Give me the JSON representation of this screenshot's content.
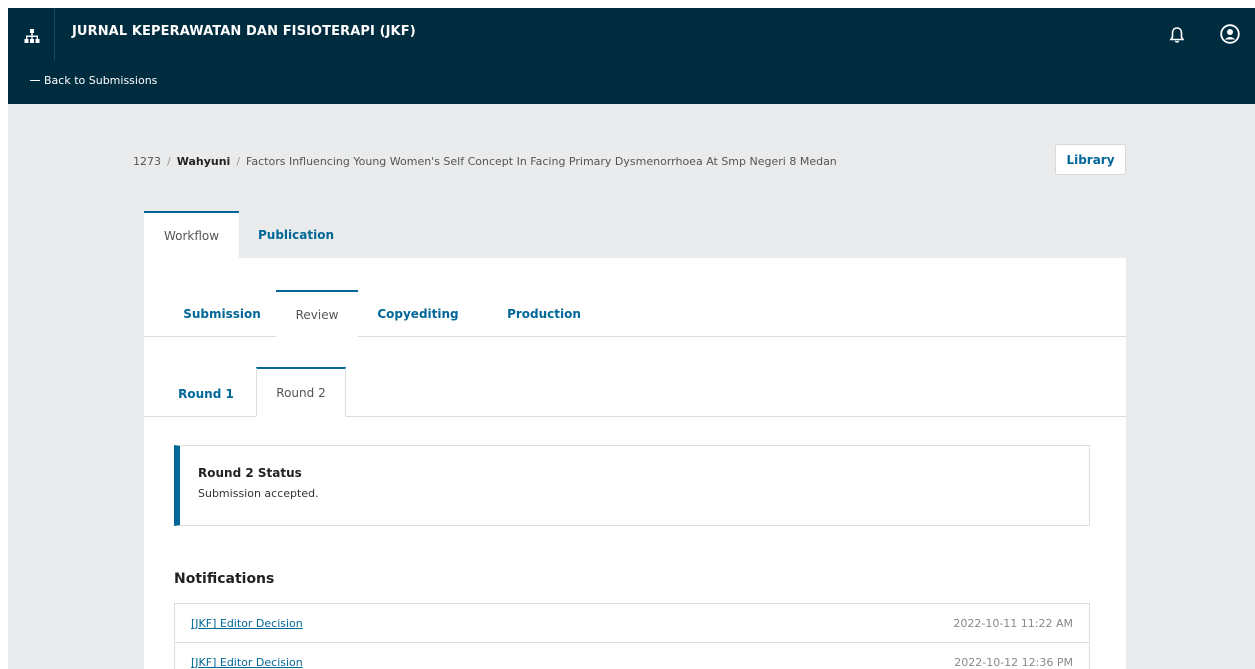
{
  "header": {
    "site_title": "JURNAL KEPERAWATAN DAN FISIOTERAPI (JKF)",
    "back_label": "Back to Submissions"
  },
  "breadcrumb": {
    "id": "1273",
    "author": "Wahyuni",
    "title": "Factors Influencing Young Women's Self Concept In Facing Primary Dysmenorrhoea At Smp Negeri 8 Medan"
  },
  "library_label": "Library",
  "main_tabs": [
    {
      "label": "Workflow",
      "active": true
    },
    {
      "label": "Publication",
      "active": false
    }
  ],
  "stage_tabs": [
    {
      "label": "Submission",
      "active": false
    },
    {
      "label": "Review",
      "active": true
    },
    {
      "label": "Copyediting",
      "active": false
    },
    {
      "label": "Production",
      "active": false
    }
  ],
  "round_tabs": [
    {
      "label": "Round 1",
      "active": false
    },
    {
      "label": "Round 2",
      "active": true
    }
  ],
  "status": {
    "title": "Round 2 Status",
    "text": "Submission accepted."
  },
  "notifications": {
    "heading": "Notifications",
    "items": [
      {
        "label": "[JKF] Editor Decision",
        "date": "2022-10-11 11:22 AM"
      },
      {
        "label": "[JKF] Editor Decision",
        "date": "2022-10-12 12:36 PM"
      }
    ]
  },
  "colors": {
    "header_bg": "#002c40",
    "accent": "#006798",
    "page_bg": "#e9ebec"
  }
}
